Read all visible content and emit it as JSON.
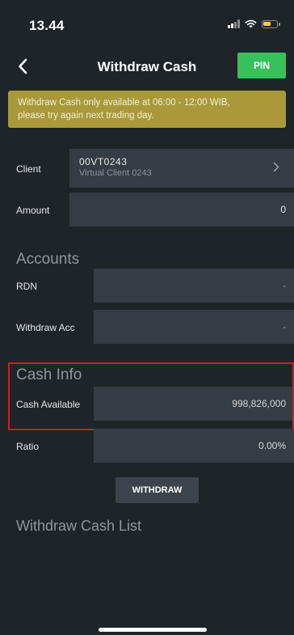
{
  "status_bar": {
    "time": "13.44",
    "icons": [
      "signal-icon",
      "wifi-icon",
      "battery-icon"
    ],
    "battery_color": "#f1d12b"
  },
  "header": {
    "back_icon": "chevron-left-icon",
    "title": "Withdraw Cash",
    "pin_label": "PIN",
    "pin_color": "#36c15a"
  },
  "banner": {
    "line1": "Withdraw Cash only available at 06:00 - 12:00 WIB,",
    "line2": "please try again next trading day.",
    "color": "#a9993a"
  },
  "client": {
    "label": "Client",
    "code": "00VT0243",
    "name": "Virtual Client 0243",
    "chevron_icon": "chevron-right-icon"
  },
  "amount": {
    "label": "Amount",
    "value": "0"
  },
  "accounts": {
    "title": "Accounts",
    "rdn_label": "RDN",
    "rdn_value": "-",
    "withdraw_acc_label": "Withdraw Acc",
    "withdraw_acc_value": "-"
  },
  "cash_info": {
    "title": "Cash Info",
    "cash_available_label": "Cash Available",
    "cash_available_value": "998,826,000",
    "ratio_label": "Ratio",
    "ratio_value": "0.00%",
    "highlight_color": "#c4222a"
  },
  "actions": {
    "withdraw_label": "WITHDRAW"
  },
  "list": {
    "title": "Withdraw Cash List"
  }
}
